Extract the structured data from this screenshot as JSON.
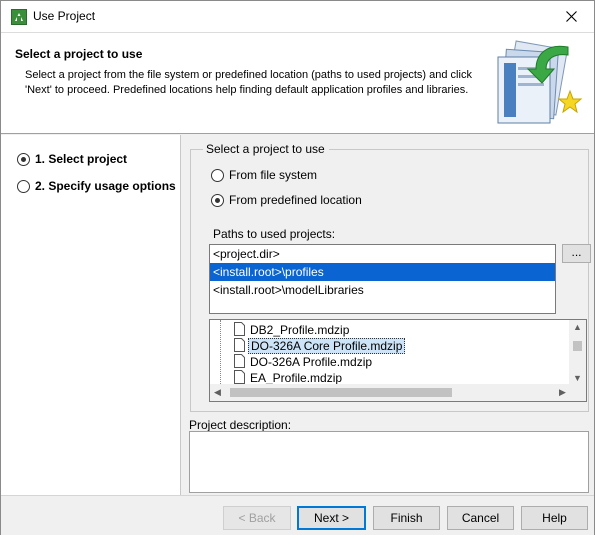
{
  "window": {
    "title": "Use Project",
    "icon": "magicdraw-app-icon",
    "close_icon": "close-icon"
  },
  "banner": {
    "title": "Select a project to use",
    "description": "Select a project from the file system or predefined location (paths to used projects) and click 'Next' to proceed. Predefined locations help finding default application profiles and libraries.",
    "image_icon": "use-project-wizard-graphic"
  },
  "steps": [
    {
      "label": "1. Select project",
      "checked": true
    },
    {
      "label": "2. Specify usage options",
      "checked": false
    }
  ],
  "source_group": {
    "label": "Select a project to use",
    "options": [
      {
        "label": "From file system",
        "checked": false
      },
      {
        "label": "From predefined location",
        "checked": true
      }
    ]
  },
  "paths": {
    "label": "Paths to used projects:",
    "items": [
      {
        "text": "<project.dir>",
        "selected": false
      },
      {
        "text": "<install.root>\\profiles",
        "selected": true
      },
      {
        "text": "<install.root>\\modelLibraries",
        "selected": false
      }
    ],
    "browse_label": "..."
  },
  "files": {
    "items": [
      {
        "name": "DB2_Profile.mdzip",
        "selected": false
      },
      {
        "name": "DO-326A Core Profile.mdzip",
        "selected": true
      },
      {
        "name": "DO-326A Profile.mdzip",
        "selected": false
      },
      {
        "name": "EA_Profile.mdzip",
        "selected": false
      }
    ]
  },
  "project_description": {
    "label": "Project description:",
    "value": ""
  },
  "footer": {
    "back_label": "< Back",
    "next_label": "Next >",
    "finish_label": "Finish",
    "cancel_label": "Cancel",
    "help_label": "Help"
  },
  "colors": {
    "selection": "#0a64d2",
    "accent": "#0078d7"
  }
}
